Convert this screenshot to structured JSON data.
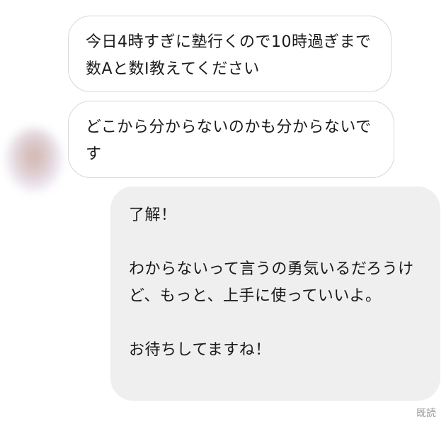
{
  "messages": {
    "incoming_1": "今日4時すぎに塾行くので10時過ぎまで数Aと数Ⅰ教えてください",
    "incoming_2": "どこから分からないのかも分からないです",
    "outgoing_1": {
      "line1": "了解！",
      "line2": "わからないって言うの勇気いるだろうけど、もっと、上手に使っていいよ。",
      "line3": "お待ちしてますね！"
    }
  },
  "status": {
    "read_label": "既読"
  },
  "colors": {
    "incoming_bg": "#ffffff",
    "incoming_border": "#d8d8d8",
    "outgoing_bg": "#efefef",
    "text": "#1a1a1a",
    "read_text": "#9a9a9a"
  }
}
